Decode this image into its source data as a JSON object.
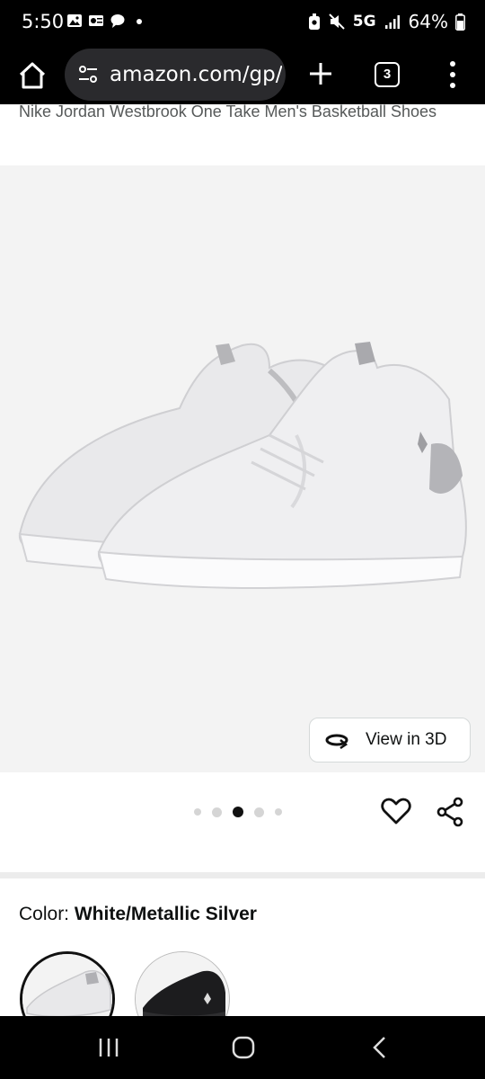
{
  "status": {
    "time": "5:50",
    "network": "5G",
    "battery": "64%"
  },
  "browser": {
    "url": "amazon.com/gp/",
    "tab_count": "3"
  },
  "product": {
    "title": "Nike Jordan Westbrook One Take Men's Basketball Shoes",
    "view3d_label": "View in 3D",
    "carousel": {
      "total": 5,
      "active_index": 2
    },
    "color_label": "Color: ",
    "color_value": "White/Metallic Silver"
  },
  "colors": {
    "accent": "#0f1111",
    "background": "#f3f3f3"
  }
}
